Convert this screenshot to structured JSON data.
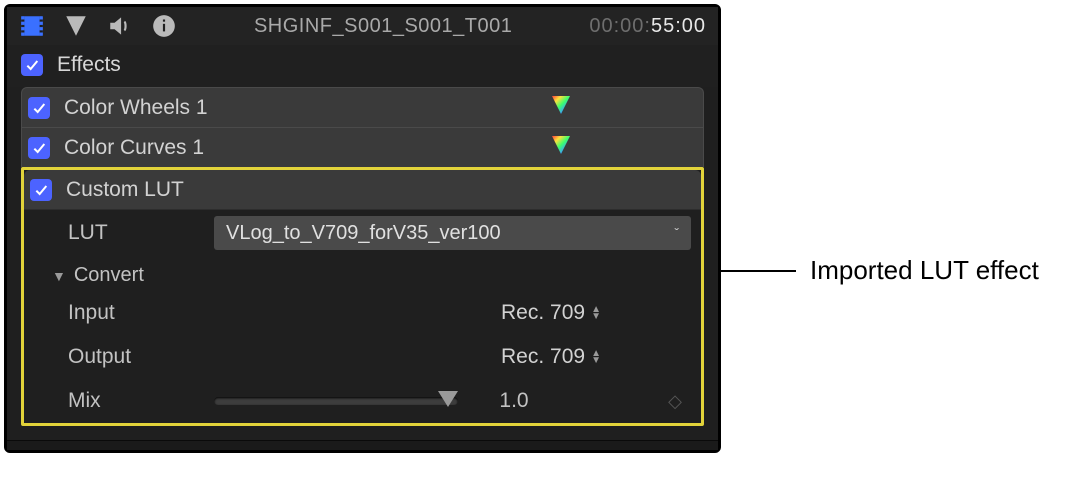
{
  "header": {
    "clip_name": "SHGINF_S001_S001_T001",
    "timecode_dim": "00:00:",
    "timecode_lit": "55:00"
  },
  "effects": {
    "title": "Effects",
    "items": [
      {
        "label": "Color Wheels 1"
      },
      {
        "label": "Color Curves 1"
      }
    ]
  },
  "custom_lut": {
    "label": "Custom LUT",
    "params": {
      "lut_label": "LUT",
      "lut_value": "VLog_to_V709_forV35_ver100",
      "convert_label": "Convert",
      "input_label": "Input",
      "input_value": "Rec. 709",
      "output_label": "Output",
      "output_value": "Rec. 709",
      "mix_label": "Mix",
      "mix_value": "1.0"
    }
  },
  "callout": {
    "text": "Imported LUT effect"
  }
}
